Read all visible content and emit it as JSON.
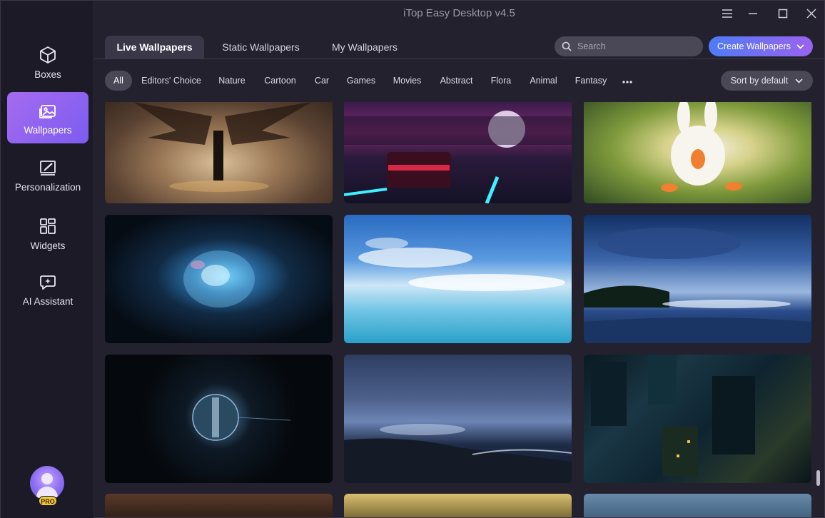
{
  "window": {
    "title": "iTop Easy Desktop v4.5",
    "controls": [
      "menu-icon",
      "minimize-icon",
      "maximize-icon",
      "close-icon"
    ]
  },
  "sidebar": {
    "items": [
      {
        "label": "Boxes",
        "icon": "box-icon",
        "active": false
      },
      {
        "label": "Wallpapers",
        "icon": "image-icon",
        "active": true
      },
      {
        "label": "Personalization",
        "icon": "brush-icon",
        "active": false
      },
      {
        "label": "Widgets",
        "icon": "widgets-icon",
        "active": false
      },
      {
        "label": "AI Assistant",
        "icon": "ai-chat-icon",
        "active": false
      }
    ],
    "account_badge": "PRO"
  },
  "tabs": [
    {
      "label": "Live Wallpapers",
      "active": true
    },
    {
      "label": "Static Wallpapers",
      "active": false
    },
    {
      "label": "My Wallpapers",
      "active": false
    }
  ],
  "search": {
    "placeholder": "Search",
    "value": ""
  },
  "create_button": {
    "label": "Create Wallpapers"
  },
  "categories": [
    "All",
    "Editors' Choice",
    "Nature",
    "Cartoon",
    "Car",
    "Games",
    "Movies",
    "Abstract",
    "Flora",
    "Animal",
    "Fantasy"
  ],
  "selected_category": "All",
  "sort": {
    "label": "Sort by default"
  },
  "colors": {
    "accent_purple": "#9a63ef",
    "accent_blue": "#4f7bf6",
    "background": "#24212f",
    "sidebar": "#1c1a26",
    "pro_badge": "#f3c640"
  }
}
